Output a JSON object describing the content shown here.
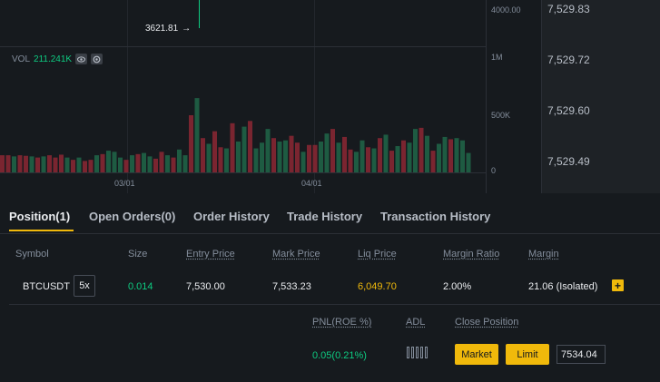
{
  "chart": {
    "price_axis": {
      "top_label": "4000.00",
      "vol_1m": "1M",
      "vol_500k": "500K",
      "vol_0": "0"
    },
    "low_marker": "3621.81",
    "vol_legend": {
      "label": "VOL",
      "value": "211.241K"
    },
    "x_ticks": [
      "03/01",
      "04/01"
    ],
    "colors": {
      "up": "#0ecb81",
      "down": "#f6465d",
      "up_bar": "#1e5b42",
      "down_bar": "#7a2530"
    },
    "volume_bars": [
      {
        "v": 150,
        "up": false
      },
      {
        "v": 150,
        "up": false
      },
      {
        "v": 140,
        "up": true
      },
      {
        "v": 150,
        "up": false
      },
      {
        "v": 145,
        "up": false
      },
      {
        "v": 140,
        "up": true
      },
      {
        "v": 130,
        "up": false
      },
      {
        "v": 140,
        "up": true
      },
      {
        "v": 150,
        "up": false
      },
      {
        "v": 130,
        "up": false
      },
      {
        "v": 155,
        "up": false
      },
      {
        "v": 130,
        "up": true
      },
      {
        "v": 110,
        "up": false
      },
      {
        "v": 130,
        "up": true
      },
      {
        "v": 100,
        "up": false
      },
      {
        "v": 110,
        "up": false
      },
      {
        "v": 150,
        "up": true
      },
      {
        "v": 160,
        "up": false
      },
      {
        "v": 190,
        "up": true
      },
      {
        "v": 180,
        "up": true
      },
      {
        "v": 130,
        "up": true
      },
      {
        "v": 110,
        "up": false
      },
      {
        "v": 150,
        "up": true
      },
      {
        "v": 160,
        "up": false
      },
      {
        "v": 170,
        "up": true
      },
      {
        "v": 140,
        "up": true
      },
      {
        "v": 120,
        "up": false
      },
      {
        "v": 180,
        "up": false
      },
      {
        "v": 150,
        "up": true
      },
      {
        "v": 130,
        "up": false
      },
      {
        "v": 200,
        "up": true
      },
      {
        "v": 150,
        "up": true
      },
      {
        "v": 500,
        "up": false
      },
      {
        "v": 650,
        "up": true
      },
      {
        "v": 300,
        "up": false
      },
      {
        "v": 250,
        "up": true
      },
      {
        "v": 360,
        "up": false
      },
      {
        "v": 220,
        "up": false
      },
      {
        "v": 210,
        "up": true
      },
      {
        "v": 430,
        "up": false
      },
      {
        "v": 270,
        "up": true
      },
      {
        "v": 400,
        "up": true
      },
      {
        "v": 450,
        "up": false
      },
      {
        "v": 210,
        "up": true
      },
      {
        "v": 260,
        "up": true
      },
      {
        "v": 380,
        "up": true
      },
      {
        "v": 300,
        "up": false
      },
      {
        "v": 270,
        "up": true
      },
      {
        "v": 280,
        "up": true
      },
      {
        "v": 320,
        "up": false
      },
      {
        "v": 260,
        "up": false
      },
      {
        "v": 180,
        "up": true
      },
      {
        "v": 240,
        "up": false
      },
      {
        "v": 240,
        "up": false
      },
      {
        "v": 270,
        "up": true
      },
      {
        "v": 340,
        "up": true
      },
      {
        "v": 380,
        "up": false
      },
      {
        "v": 260,
        "up": true
      },
      {
        "v": 310,
        "up": false
      },
      {
        "v": 200,
        "up": false
      },
      {
        "v": 180,
        "up": true
      },
      {
        "v": 280,
        "up": true
      },
      {
        "v": 220,
        "up": false
      },
      {
        "v": 210,
        "up": true
      },
      {
        "v": 300,
        "up": false
      },
      {
        "v": 330,
        "up": true
      },
      {
        "v": 190,
        "up": false
      },
      {
        "v": 230,
        "up": true
      },
      {
        "v": 280,
        "up": false
      },
      {
        "v": 260,
        "up": true
      },
      {
        "v": 380,
        "up": true
      },
      {
        "v": 390,
        "up": false
      },
      {
        "v": 320,
        "up": true
      },
      {
        "v": 190,
        "up": false
      },
      {
        "v": 250,
        "up": true
      },
      {
        "v": 310,
        "up": true
      },
      {
        "v": 290,
        "up": false
      },
      {
        "v": 300,
        "up": true
      },
      {
        "v": 280,
        "up": true
      },
      {
        "v": 170,
        "up": true
      }
    ]
  },
  "orderbook_prices": [
    "7,529.83",
    "7,529.72",
    "7,529.60",
    "7,529.49"
  ],
  "tabs": [
    {
      "label": "Position(1)",
      "active": true
    },
    {
      "label": "Open Orders(0)",
      "active": false
    },
    {
      "label": "Order History",
      "active": false
    },
    {
      "label": "Trade History",
      "active": false
    },
    {
      "label": "Transaction History",
      "active": false
    }
  ],
  "position": {
    "headers": {
      "symbol": "Symbol",
      "size": "Size",
      "entry_price": "Entry Price",
      "mark_price": "Mark Price",
      "liq_price": "Liq Price",
      "margin_ratio": "Margin Ratio",
      "margin": "Margin",
      "pnl": "PNL(ROE %)",
      "adl": "ADL",
      "close_position": "Close Position"
    },
    "row": {
      "symbol": "BTCUSDT",
      "leverage": "5x",
      "size": "0.014",
      "entry_price": "7,530.00",
      "mark_price": "7,533.23",
      "liq_price": "6,049.70",
      "margin_ratio": "2.00%",
      "margin": "21.06 (Isolated)",
      "pnl": "0.05(0.21%)"
    },
    "buttons": {
      "market": "Market",
      "limit": "Limit"
    },
    "limit_price_value": "7534.04"
  }
}
